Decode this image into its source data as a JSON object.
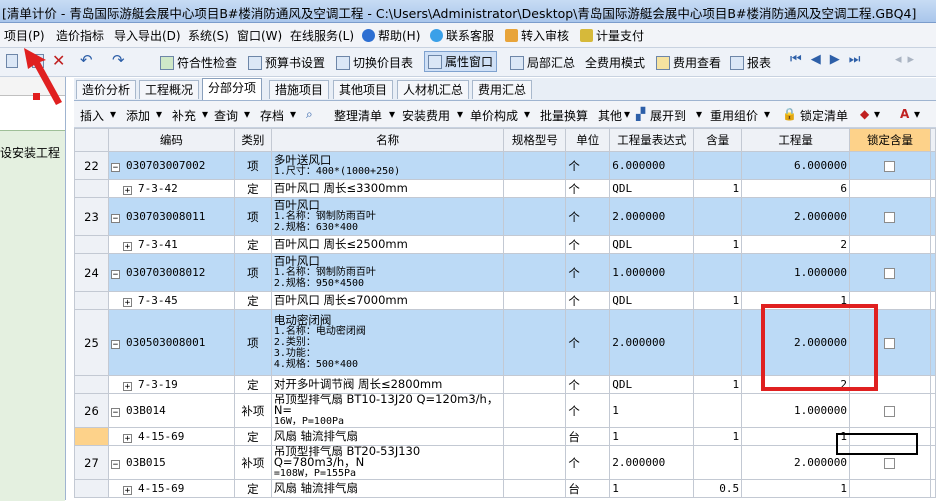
{
  "window": {
    "title": "[清单计价 - 青岛国际游艇会展中心项目B#楼消防通风及空调工程 - C:\\Users\\Administrator\\Desktop\\青岛国际游艇会展中心项目B#楼消防通风及空调工程.GBQ4]"
  },
  "menubar": {
    "items": [
      "项目(P)",
      "造价指标",
      "导入导出(D)",
      "系统(S)",
      "窗口(W)",
      "在线服务(L)",
      "帮助(H)",
      "联系客服",
      "转入审核",
      "计量支付"
    ]
  },
  "toolbar": {
    "items": [
      "符合性检查",
      "预算书设置",
      "切换价目表",
      "属性窗口",
      "局部汇总",
      "全费用模式",
      "费用查看",
      "报表"
    ]
  },
  "left_panel": {
    "label": "设安装工程"
  },
  "tabs": [
    "造价分析",
    "工程概况",
    "分部分项",
    "措施项目",
    "其他项目",
    "人材机汇总",
    "费用汇总"
  ],
  "active_tab": "分部分项",
  "toolbar2": {
    "items": [
      "插入",
      "添加",
      "补充",
      "查询",
      "存档",
      "整理清单",
      "安装费用",
      "单价构成",
      "批量换算",
      "其他",
      "展开到",
      "重用组价",
      "锁定清单"
    ]
  },
  "grid": {
    "columns": [
      "编码",
      "类别",
      "名称",
      "规格型号",
      "单位",
      "工程量表达式",
      "含量",
      "工程量",
      "锁定含量"
    ],
    "rows": [
      {
        "no": "22",
        "kind": "main",
        "code": "030703007002",
        "type": "项",
        "name": [
          "多叶送风口",
          "1.尺寸：400*(1000+250)"
        ],
        "spec": "",
        "unit": "个",
        "expr": "6.000000",
        "content": "",
        "qty": "6.000000",
        "lock": true
      },
      {
        "no": "",
        "kind": "sub",
        "code": "7-3-42",
        "type": "定",
        "name": [
          "百叶风口 周长≤3300mm"
        ],
        "spec": "",
        "unit": "个",
        "expr": "QDL",
        "content": "1",
        "qty": "6",
        "lock": false
      },
      {
        "no": "23",
        "kind": "main",
        "code": "030703008011",
        "type": "项",
        "name": [
          "百叶风口",
          "1.名称：钢制防雨百叶",
          "2.规格：630*400"
        ],
        "spec": "",
        "unit": "个",
        "expr": "2.000000",
        "content": "",
        "qty": "2.000000",
        "lock": true
      },
      {
        "no": "",
        "kind": "sub",
        "code": "7-3-41",
        "type": "定",
        "name": [
          "百叶风口 周长≤2500mm"
        ],
        "spec": "",
        "unit": "个",
        "expr": "QDL",
        "content": "1",
        "qty": "2",
        "lock": false
      },
      {
        "no": "24",
        "kind": "main",
        "code": "030703008012",
        "type": "项",
        "name": [
          "百叶风口",
          "1.名称：钢制防雨百叶",
          "2.规格：950*4500"
        ],
        "spec": "",
        "unit": "个",
        "expr": "1.000000",
        "content": "",
        "qty": "1.000000",
        "lock": true
      },
      {
        "no": "",
        "kind": "sub",
        "code": "7-3-45",
        "type": "定",
        "name": [
          "百叶风口 周长≤7000mm"
        ],
        "spec": "",
        "unit": "个",
        "expr": "QDL",
        "content": "1",
        "qty": "1",
        "lock": false
      },
      {
        "no": "25",
        "kind": "main",
        "code": "030503008001",
        "type": "项",
        "name": [
          "电动密闭阀",
          "1.名称：电动密闭阀",
          "2.类别：",
          "3.功能：",
          "4.规格：500*400"
        ],
        "spec": "",
        "unit": "个",
        "expr": "2.000000",
        "content": "",
        "qty": "2.000000",
        "lock": true
      },
      {
        "no": "",
        "kind": "sub",
        "code": "7-3-19",
        "type": "定",
        "name": [
          "对开多叶调节阀 周长≤2800mm"
        ],
        "spec": "",
        "unit": "个",
        "expr": "QDL",
        "content": "1",
        "qty": "2",
        "lock": false
      },
      {
        "no": "26",
        "kind": "main-plain",
        "code": "03B014",
        "type": "补项",
        "name": [
          "吊顶型排气扇 BT10-13J20 Q=120m3/h，N=",
          "16W，P=100Pa"
        ],
        "spec": "",
        "unit": "个",
        "expr": "1",
        "content": "",
        "qty": "1.000000",
        "lock": true
      },
      {
        "no": "",
        "kind": "sub-sel",
        "code": "4-15-69",
        "type": "定",
        "name": [
          "风扇 轴流排气扇"
        ],
        "spec": "",
        "unit": "台",
        "expr": "1",
        "content": "1",
        "qty": "1",
        "lock": false
      },
      {
        "no": "27",
        "kind": "main-plain",
        "code": "03B015",
        "type": "补项",
        "name": [
          "吊顶型排气扇 BT20-53J130 Q=780m3/h，N",
          "=108W，P=155Pa"
        ],
        "spec": "",
        "unit": "个",
        "expr": "2.000000",
        "content": "",
        "qty": "2.000000",
        "lock": true
      },
      {
        "no": "",
        "kind": "sub",
        "code": "4-15-69",
        "type": "定",
        "name": [
          "风扇 轴流排气扇"
        ],
        "spec": "",
        "unit": "台",
        "expr": "1",
        "content": "0.5",
        "qty": "1",
        "lock": false
      }
    ]
  },
  "colors": {
    "highlight": "#bcdaf6",
    "annotation_red": "#e02020",
    "lock_header": "#fdd28a"
  }
}
